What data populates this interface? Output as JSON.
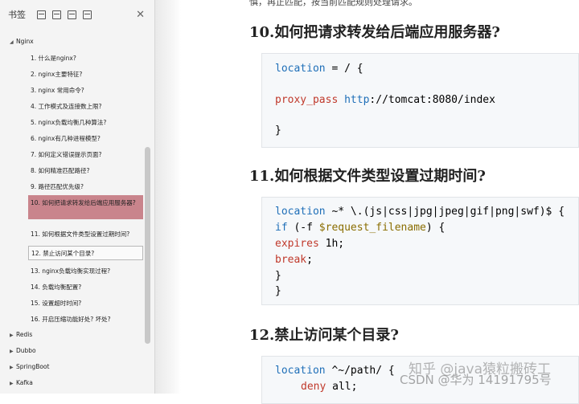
{
  "sidebar": {
    "title": "书签",
    "tree": [
      {
        "label": "Nginx",
        "expanded": true
      },
      {
        "label": "Redis",
        "expanded": false
      },
      {
        "label": "Dubbo",
        "expanded": false
      },
      {
        "label": "SpringBoot",
        "expanded": false
      },
      {
        "label": "Kafka",
        "expanded": false
      }
    ],
    "items": [
      "1. 什么是nginx?",
      "2. nginx主要特征?",
      "3. nginx 常用命令?",
      "4. 工作模式及连接数上限?",
      "5. nginx负载均衡几种算法?",
      "6. nginx有几种进程模型?",
      "7. 如何定义错误提示页面?",
      "8. 如何精准匹配路径?",
      "9. 路径匹配优先级?",
      "10. 如何把请求转发给后端应用服务器?",
      "11. 如何根据文件类型设置过期时间?",
      "12. 禁止访问某个目录?",
      "13. nginx负载均衡实现过程?",
      "14. 负载均衡配置?",
      "15. 设置超时时间?",
      "16. 开启压缩功能好处? 坏处?"
    ],
    "active_index": 9,
    "outlined_index": 11
  },
  "doc": {
    "top_text": "慎，再正匹配，按当前匹配规则处理请求。",
    "headings": [
      "10.如何把请求转发给后端应用服务器?",
      "11.如何根据文件类型设置过期时间?",
      "12.禁止访问某个目录?"
    ]
  },
  "watermark": {
    "line1": "知乎 @java猿粒搬砖工",
    "line2": "CSDN @华为 14191795号"
  }
}
